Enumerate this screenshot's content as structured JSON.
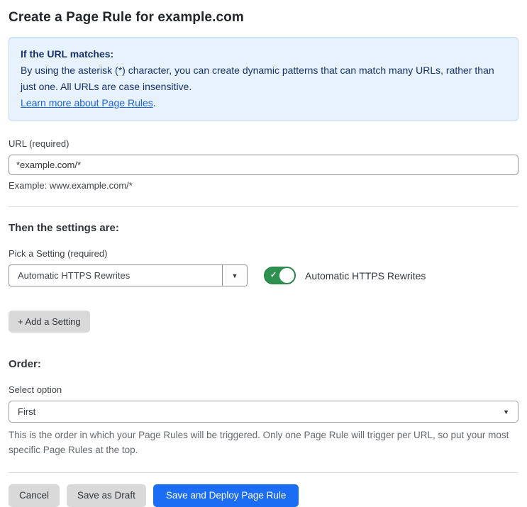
{
  "page": {
    "title": "Create a Page Rule for example.com"
  },
  "info_box": {
    "heading": "If the URL matches:",
    "body": "By using the asterisk (*) character, you can create dynamic patterns that can match many URLs, rather than just one. All URLs are case insensitive.",
    "link_label": "Learn more about Page Rules",
    "link_suffix": "."
  },
  "url_field": {
    "label": "URL (required)",
    "value": "*example.com/*",
    "helper": "Example: www.example.com/*"
  },
  "settings_section": {
    "heading": "Then the settings are:",
    "picker_label": "Pick a Setting (required)",
    "picker_value": "Automatic HTTPS Rewrites",
    "dropdown_arrow": "▼",
    "toggle_state": "on",
    "toggle_check": "✓",
    "toggle_label": "Automatic HTTPS Rewrites",
    "add_setting_label": "+ Add a Setting"
  },
  "order_section": {
    "heading": "Order:",
    "select_label": "Select option",
    "select_value": "First",
    "select_arrow": "▼",
    "helper": "This is the order in which your Page Rules will be triggered. Only one Page Rule will trigger per URL, so put your most specific Page Rules at the top."
  },
  "footer": {
    "cancel_label": "Cancel",
    "save_draft_label": "Save as Draft",
    "save_deploy_label": "Save and Deploy Page Rule"
  },
  "colors": {
    "info_background": "#e8f2fd",
    "info_border": "#bed9f3",
    "info_text": "#17326b",
    "link_blue": "#1d63dc",
    "toggle_green": "#2f9150",
    "primary_blue": "#1b6ef3",
    "button_gray": "#d9d9d9"
  }
}
